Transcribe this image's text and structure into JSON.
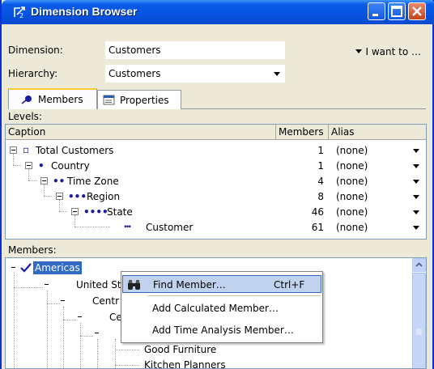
{
  "window": {
    "title": "Dimension Browser",
    "controls": [
      "minimize",
      "maximize",
      "close"
    ],
    "accent": "#0a5ae8"
  },
  "dimension": {
    "label": "Dimension:",
    "value": "Customers"
  },
  "hierarchy": {
    "label": "Hierarchy:",
    "value": "Customers"
  },
  "i_want_to": "I want to …",
  "tabs": [
    {
      "label": "Members",
      "icon": "pin-icon",
      "active": true
    },
    {
      "label": "Properties",
      "icon": "properties-icon",
      "active": false
    }
  ],
  "levels": {
    "label": "Levels:",
    "columns": [
      "Caption",
      "Members",
      "Alias"
    ],
    "rows": [
      {
        "caption": "Total Customers",
        "members": "1",
        "alias": "(none)"
      },
      {
        "caption": "Country",
        "members": "1",
        "alias": "(none)"
      },
      {
        "caption": "Time Zone",
        "members": "4",
        "alias": "(none)"
      },
      {
        "caption": "Region",
        "members": "8",
        "alias": "(none)"
      },
      {
        "caption": "State",
        "members": "46",
        "alias": "(none)"
      },
      {
        "caption": "Customer",
        "members": "61",
        "alias": "(none)"
      }
    ]
  },
  "members": {
    "label": "Members:",
    "tree": [
      {
        "label": "Americas",
        "selected": true
      },
      {
        "label": "United St"
      },
      {
        "label": "Centr"
      },
      {
        "label": "Ce"
      },
      {
        "label": ""
      },
      {
        "label": "Good Furniture"
      },
      {
        "label": "Kitchen Planners"
      }
    ]
  },
  "context_menu": {
    "items": [
      {
        "label": "Find Member…",
        "shortcut": "Ctrl+F",
        "icon": "binoculars-icon"
      },
      {
        "label": "Add Calculated Member…",
        "shortcut": ""
      },
      {
        "label": "Add Time Analysis Member…",
        "shortcut": ""
      }
    ]
  }
}
